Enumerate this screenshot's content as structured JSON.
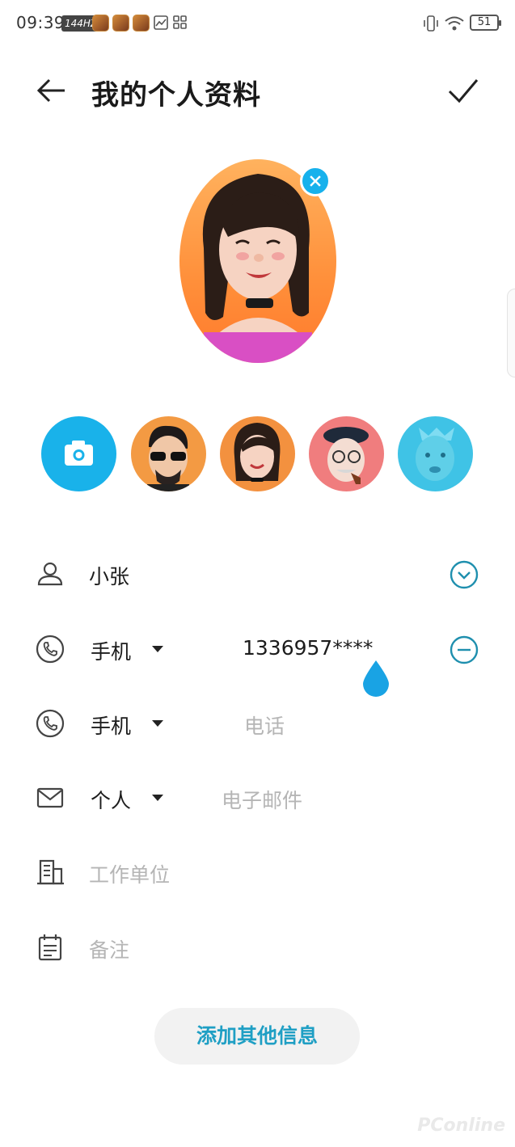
{
  "status_bar": {
    "time": "09:39",
    "refresh_rate": "144HZ",
    "battery": "51",
    "app_icons": [
      "game-app-icon",
      "game-app-icon",
      "game-app-icon",
      "gallery-icon",
      "apps-grid-icon"
    ]
  },
  "header": {
    "title": "我的个人资料",
    "back_icon": "back-arrow-icon",
    "confirm_icon": "check-icon"
  },
  "avatar": {
    "remove_icon": "close-icon",
    "choices": [
      "camera",
      "memoji-sunglasses",
      "memoji-braids",
      "memoji-beret-pipe",
      "memoji-cyan"
    ]
  },
  "form": {
    "name": {
      "value": "小张",
      "icon": "person-icon",
      "action_icon": "expand-down-icon"
    },
    "phone1": {
      "type": "手机",
      "value": "1336957****",
      "icon": "phone-icon",
      "action_icon": "minus-circle-icon"
    },
    "phone2": {
      "type": "手机",
      "placeholder": "电话",
      "icon": "phone-icon"
    },
    "email": {
      "type": "个人",
      "placeholder": "电子邮件",
      "icon": "mail-icon"
    },
    "company": {
      "placeholder": "工作单位",
      "icon": "building-icon"
    },
    "notes": {
      "placeholder": "备注",
      "icon": "notes-icon"
    }
  },
  "add_info_label": "添加其他信息",
  "watermark": "PConline",
  "colors": {
    "accent": "#19b2ea",
    "accent_dark": "#1f9fc4",
    "avatar_bg": "#ff8f3a"
  }
}
